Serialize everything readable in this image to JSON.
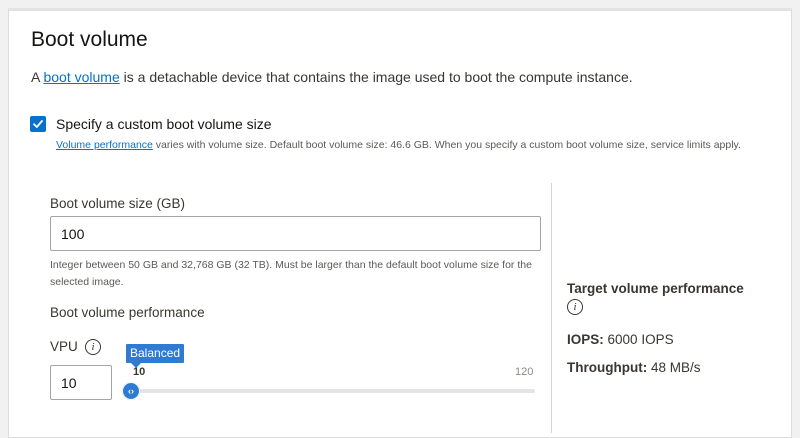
{
  "section": {
    "title": "Boot volume",
    "desc_prefix": "A ",
    "desc_link": "boot volume",
    "desc_suffix": " is a detachable device that contains the image used to boot the compute instance."
  },
  "custom_size": {
    "checked": true,
    "label": "Specify a custom boot volume size",
    "helper_link": "Volume performance",
    "helper_text": " varies with volume size. Default boot volume size: 46.6 GB. When you specify a custom boot volume size, service limits apply."
  },
  "size_field": {
    "label": "Boot volume size (GB)",
    "value": "100",
    "help": "Integer between 50 GB and 32,768 GB (32 TB). Must be larger than the default boot volume size for the selected image."
  },
  "performance": {
    "label": "Boot volume performance",
    "vpu_label": "VPU",
    "vpu_value": "10",
    "slider": {
      "tooltip": "Balanced",
      "min_label": "10",
      "max_label": "120",
      "value": 10,
      "min": 10,
      "max": 120
    }
  },
  "target": {
    "title": "Target volume performance",
    "iops_label": "IOPS:",
    "iops_value": "6000 IOPS",
    "throughput_label": "Throughput:",
    "throughput_value": "48 MB/s"
  },
  "icons": {
    "info": "i",
    "slider_thumb": "‹›"
  },
  "colors": {
    "accent": "#0572ce",
    "slider": "#2f7bd1"
  }
}
